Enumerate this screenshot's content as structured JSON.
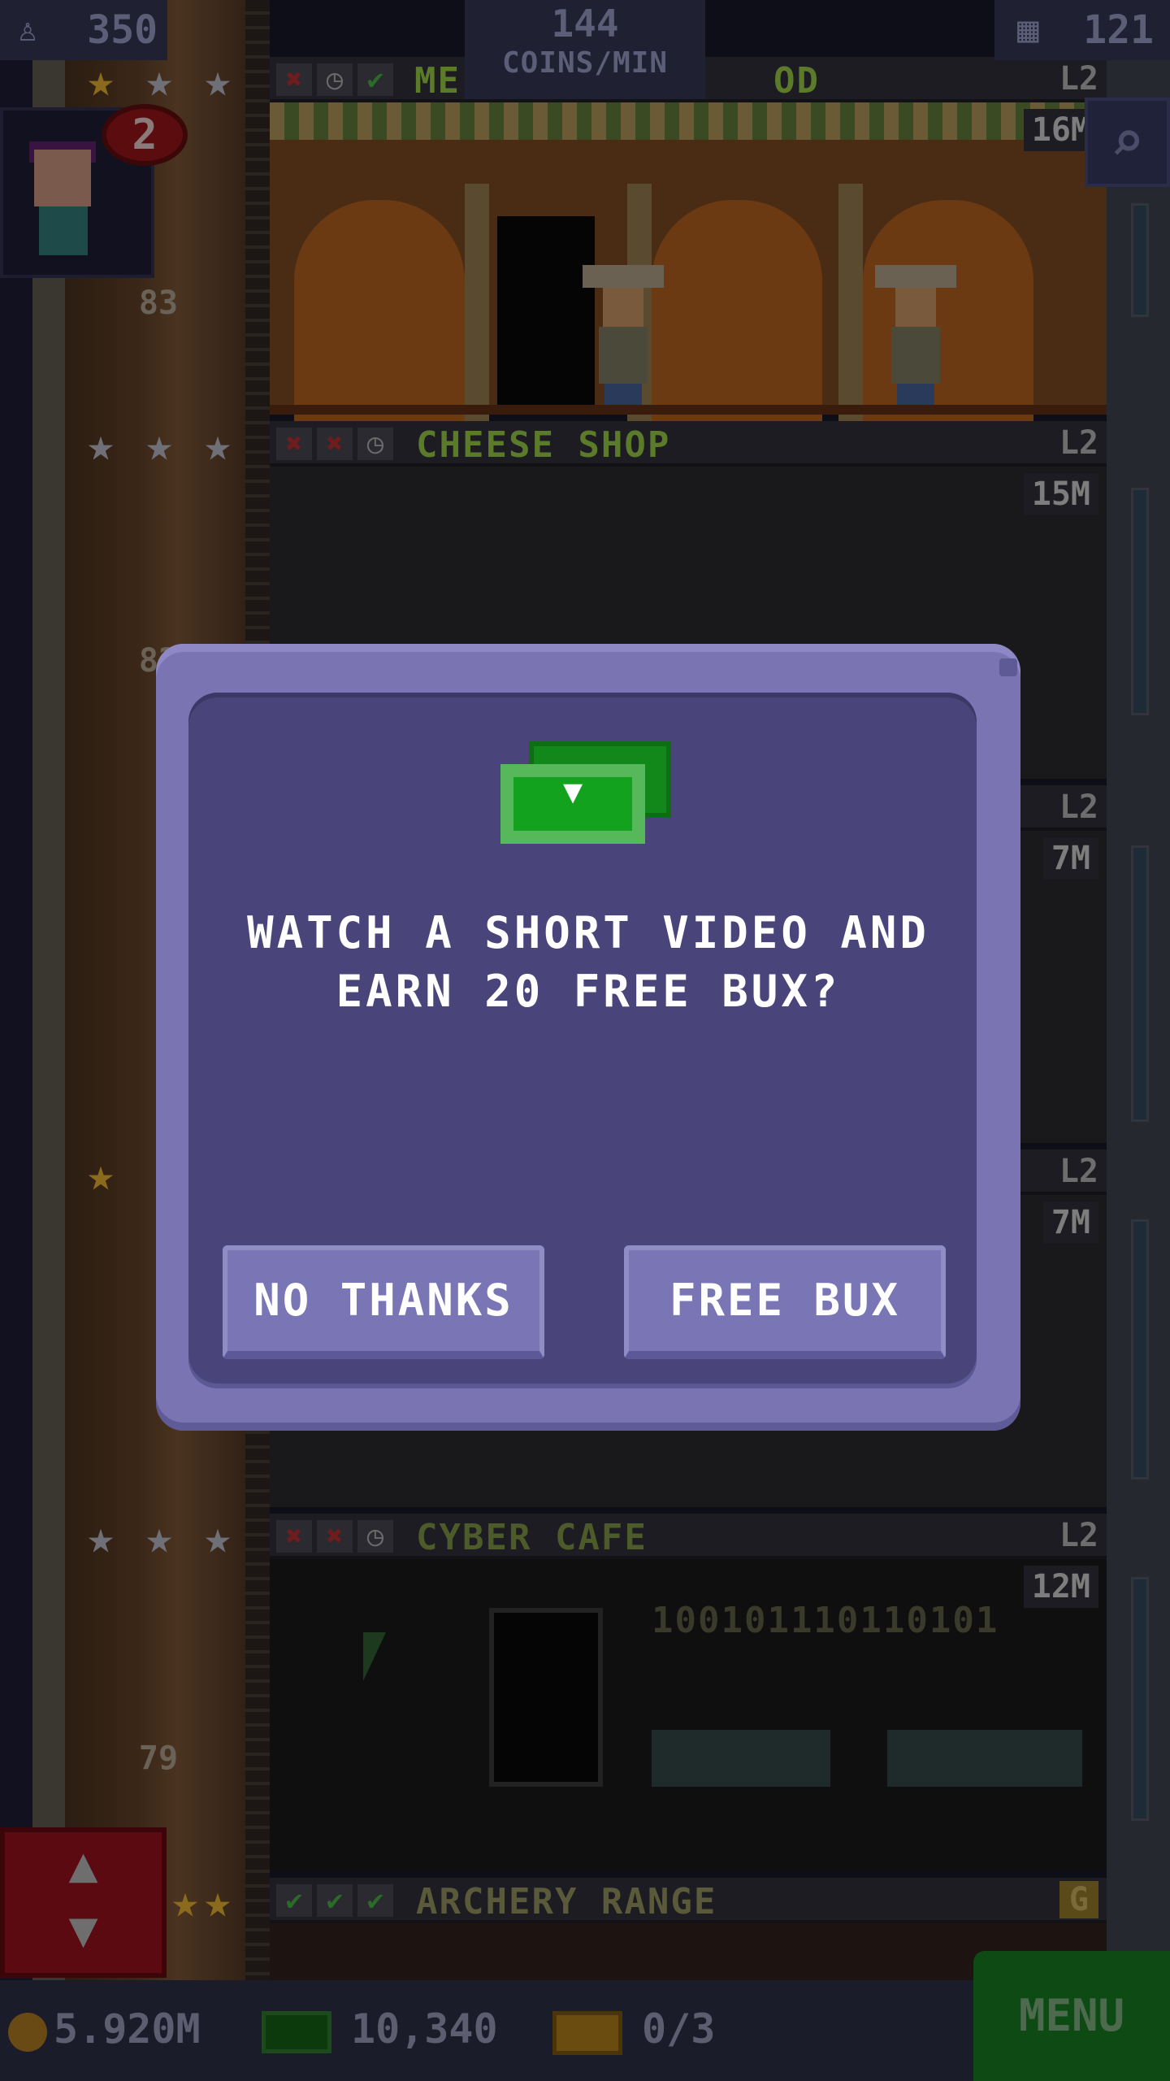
{
  "hud": {
    "population": "350",
    "coins_per_min_value": "144",
    "coins_per_min_label": "COINS/MIN",
    "floor_count": "121",
    "visitor_badge": "2"
  },
  "floors": [
    {
      "name": "ME",
      "name_suffix": "OD",
      "level": "L2",
      "time": "16M",
      "stars": 3,
      "gold_stars": 1,
      "number": "83"
    },
    {
      "name": "CHEESE SHOP",
      "level": "L2",
      "time": "15M",
      "stars": 3,
      "gold_stars": 0,
      "number": "82"
    },
    {
      "level": "L2",
      "time": "7M"
    },
    {
      "level": "L2",
      "time": "7M"
    },
    {
      "name": "CYBER CAFE",
      "level": "L2",
      "time": "12M",
      "stars": 3,
      "gold_stars": 0,
      "number": "79",
      "binary": "100101110110101"
    },
    {
      "name": "ARCHERY RANGE",
      "level": "G",
      "stars": 3,
      "gold_stars": 2
    }
  ],
  "dialog": {
    "message_line1": "WATCH A SHORT VIDEO AND",
    "message_line2": "EARN 20 FREE BUX?",
    "no_button": "NO THANKS",
    "yes_button": "FREE BUX"
  },
  "bottom": {
    "coins": "5.920M",
    "bux": "10,340",
    "chests": "0/3",
    "menu": "MENU"
  },
  "colors": {
    "dialog_outer": "#7b74b3",
    "dialog_inner": "#49457b",
    "bux_green": "#13a21d",
    "button": "#7a76b5"
  }
}
